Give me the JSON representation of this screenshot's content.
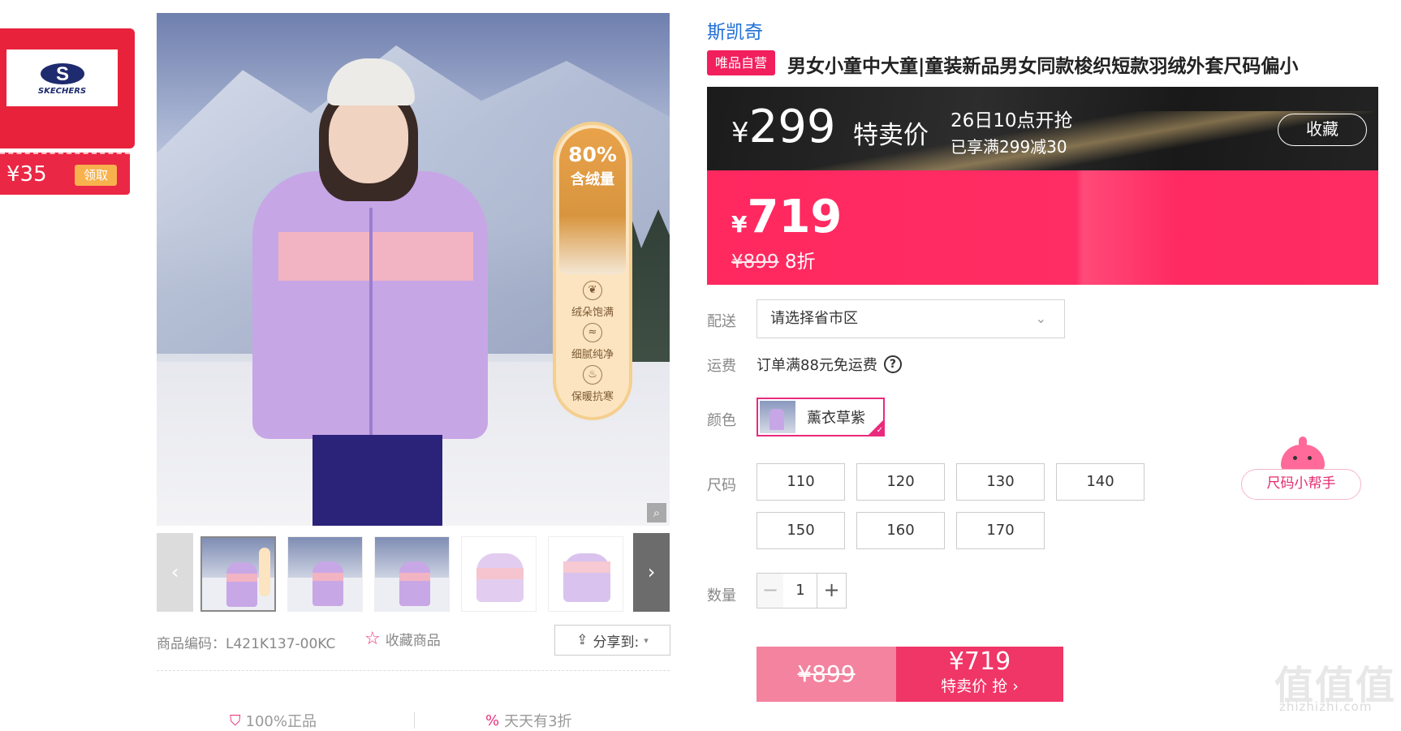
{
  "coupon": {
    "brand_logo_text": "SKECHERS",
    "amount": "¥35",
    "claim_label": "领取"
  },
  "gallery": {
    "badge": {
      "percent": "80%",
      "subtitle": "含绒量",
      "features": [
        "绒朵饱满",
        "细腻纯净",
        "保暖抗寒"
      ]
    },
    "thumbnails_count": 5,
    "prev_icon": "chevron-left-icon",
    "next_icon": "chevron-right-icon"
  },
  "meta": {
    "sku": "商品编码：L421K137-00KC",
    "favorite": "收藏商品",
    "share": "分享到:"
  },
  "promises": [
    "100%正品",
    "天天有3折"
  ],
  "product": {
    "brand": "斯凯奇",
    "self_operated_tag": "唯品自营",
    "title": "男女小童中大童|童装新品男女同款梭织短款羽绒外套尺码偏小"
  },
  "flash_sale": {
    "currency": "¥",
    "price": "299",
    "label": "特卖价",
    "start_time": "26日10点开抢",
    "discount_note": "已享满299减30",
    "favorite_button": "收藏"
  },
  "current_price": {
    "currency": "¥",
    "price": "719",
    "original": "¥899",
    "discount": "8折"
  },
  "delivery": {
    "label": "配送",
    "placeholder": "请选择省市区"
  },
  "shipping": {
    "label": "运费",
    "text": "订单满88元免运费"
  },
  "color": {
    "label": "颜色",
    "selected": "薰衣草紫"
  },
  "size": {
    "label": "尺码",
    "options": [
      "110",
      "120",
      "130",
      "140",
      "150",
      "160",
      "170"
    ],
    "helper": "尺码小帮手"
  },
  "quantity": {
    "label": "数量",
    "value": "1",
    "minus": "−",
    "plus": "+"
  },
  "buy": {
    "original": "¥899",
    "price": "¥719",
    "label": "特卖价 抢 ›"
  },
  "watermark": {
    "text": "值值值",
    "site": "zhizhizhi.com"
  },
  "colors": {
    "accent": "#f21f5d",
    "brand_link": "#1f6fd6",
    "price_band": "#ff285f",
    "flash_bg": "#1b1b1b"
  }
}
